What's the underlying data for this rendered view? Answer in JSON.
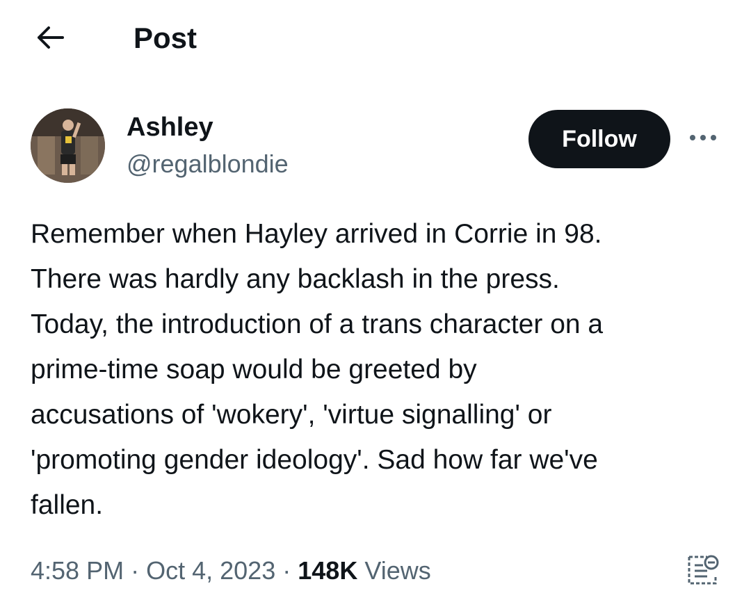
{
  "header": {
    "back_icon": "arrow-left-icon",
    "title": "Post"
  },
  "author": {
    "avatar_icon": "avatar",
    "name": "Ashley",
    "handle": "@regalblondie",
    "follow_label": "Follow",
    "more_icon": "more-dots-icon"
  },
  "tweet": {
    "text": "Remember when Hayley arrived in Corrie in 98.\nThere was hardly any backlash in the press.\nToday, the introduction of a trans character on a\nprime-time soap would be greeted by\naccusations of 'wokery', 'virtue signalling' or\n'promoting gender ideology'. Sad how far we've\nfallen."
  },
  "meta": {
    "time": "4:58 PM",
    "separator": "·",
    "date": "Oct 4, 2023",
    "views_count": "148K",
    "views_label": "Views",
    "analytics_icon": "post-analytics-icon"
  },
  "colors": {
    "text_primary": "#0f1419",
    "text_secondary": "#536471",
    "follow_bg": "#0f1419",
    "background": "#ffffff"
  }
}
